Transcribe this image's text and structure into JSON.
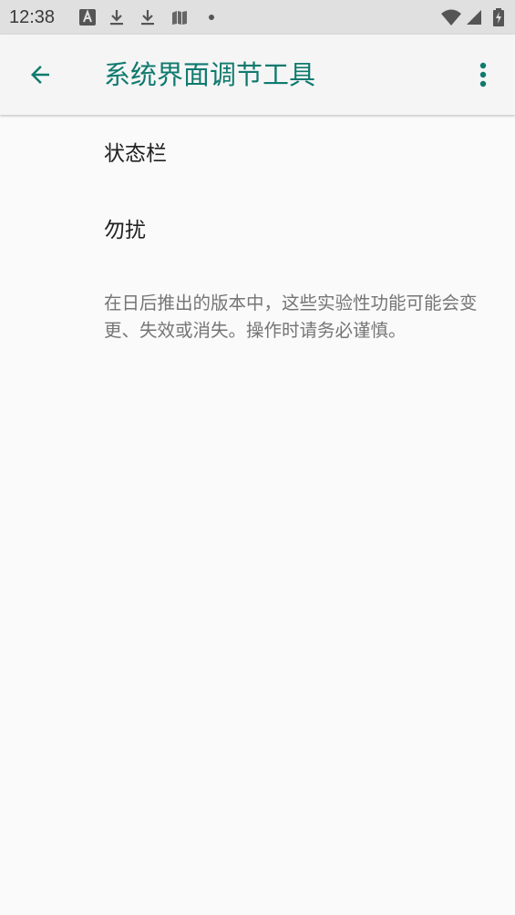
{
  "status_bar": {
    "time": "12:38",
    "icons": [
      "font-a-icon",
      "download-icon",
      "download-icon",
      "book-icon",
      "dot-icon",
      "wifi-icon",
      "cell-signal-icon",
      "battery-charging-icon"
    ]
  },
  "app_bar": {
    "title": "系统界面调节工具",
    "back_icon": "arrow-back-icon",
    "overflow_icon": "more-vert-icon"
  },
  "preferences": [
    {
      "title": "状态栏"
    },
    {
      "title": "勿扰"
    }
  ],
  "footer": {
    "text": "在日后推出的版本中，这些实验性功能可能会变更、失效或消失。操作时请务必谨慎。"
  },
  "colors": {
    "accent": "#0f7a6e",
    "status_bar_bg": "#e0e0e0",
    "app_bar_bg": "#f5f5f5",
    "background": "#fafafa",
    "primary_text": "#212121",
    "secondary_text": "#757575"
  }
}
